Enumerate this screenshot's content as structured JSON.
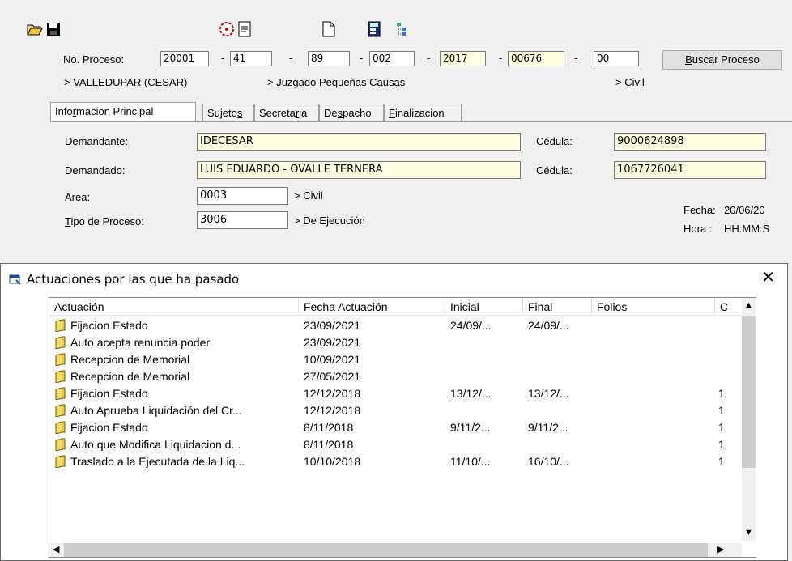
{
  "toolbar": {
    "icons": [
      "folder-open-icon",
      "save-icon",
      "target-icon",
      "document-icon",
      "new-document-icon",
      "calculator-icon",
      "tree-icon"
    ]
  },
  "process": {
    "label": "No. Proceso:",
    "part1": "20001",
    "part2": "41",
    "part3": "89",
    "part4": "002",
    "part5": "2017",
    "part6": "00676",
    "part7": "00",
    "sep": "-",
    "search_button": "Buscar Proceso"
  },
  "location": {
    "city": "> VALLEDUPAR (CESAR)",
    "court": "> Juzgado Pequeñas Causas",
    "area": "> Civil"
  },
  "tabs": [
    {
      "label": "Informacion Principal"
    },
    {
      "label": "Sujetos"
    },
    {
      "label": "Secretaria"
    },
    {
      "label": "Despacho"
    },
    {
      "label": "Finalizacion"
    }
  ],
  "main": {
    "demandante_label": "Demandante:",
    "demandante": "IDECESAR",
    "cedula_label": "Cédula:",
    "demandante_cedula": "9000624898",
    "demandado_label": "Demandado:",
    "demandado": "LUIS EDUARDO - OVALLE TERNERA",
    "demandado_cedula": "1067726041",
    "area_label": "Area:",
    "area_code": "0003",
    "area_name": "> Civil",
    "tipo_label": "Tipo de Proceso:",
    "tipo_code": "3006",
    "tipo_name": "> De Ejecución",
    "fecha_label": "Fecha:",
    "fecha_value": "20/06/20",
    "hora_label": "Hora :",
    "hora_value": "HH:MM:S"
  },
  "dialog": {
    "title": "Actuaciones por las que ha pasado",
    "close": "✕",
    "columns": [
      "Actuación",
      "Fecha Actuación",
      "Inicial",
      "Final",
      "Folios",
      "C"
    ],
    "rows": [
      {
        "actuacion": "Fijacion Estado",
        "fecha": "23/09/2021",
        "inicial": "24/09/...",
        "final": "24/09/...",
        "folios": "",
        "c": ""
      },
      {
        "actuacion": "Auto acepta renuncia poder",
        "fecha": "23/09/2021",
        "inicial": "",
        "final": "",
        "folios": "",
        "c": ""
      },
      {
        "actuacion": "Recepcion de Memorial",
        "fecha": "10/09/2021",
        "inicial": "",
        "final": "",
        "folios": "",
        "c": ""
      },
      {
        "actuacion": "Recepcion de Memorial",
        "fecha": "27/05/2021",
        "inicial": "",
        "final": "",
        "folios": "",
        "c": ""
      },
      {
        "actuacion": "Fijacion Estado",
        "fecha": "12/12/2018",
        "inicial": "13/12/...",
        "final": "13/12/...",
        "folios": "",
        "c": "1"
      },
      {
        "actuacion": "Auto Aprueba Liquidación del Cr...",
        "fecha": "12/12/2018",
        "inicial": "",
        "final": "",
        "folios": "",
        "c": "1"
      },
      {
        "actuacion": "Fijacion Estado",
        "fecha": "8/11/2018",
        "inicial": "9/11/2...",
        "final": "9/11/2...",
        "folios": "",
        "c": "1"
      },
      {
        "actuacion": "Auto que Modifica Liquidacion d...",
        "fecha": "8/11/2018",
        "inicial": "",
        "final": "",
        "folios": "",
        "c": "1"
      },
      {
        "actuacion": "Traslado a la Ejecutada de la Liq...",
        "fecha": "10/10/2018",
        "inicial": "11/10/...",
        "final": "16/10/...",
        "folios": "",
        "c": "1"
      }
    ]
  }
}
